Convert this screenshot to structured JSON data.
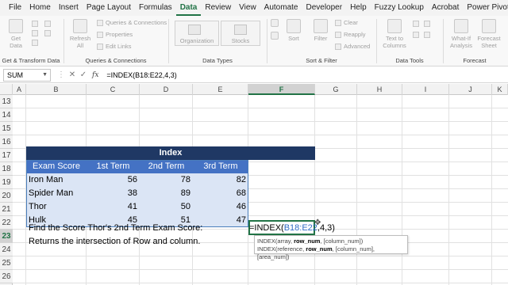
{
  "menu": {
    "tabs": [
      "File",
      "Home",
      "Insert",
      "Page Layout",
      "Formulas",
      "Data",
      "Review",
      "View",
      "Automate",
      "Developer",
      "Help",
      "Fuzzy Lookup",
      "Acrobat",
      "Power Pivot"
    ],
    "active": "Data"
  },
  "ribbon": {
    "get_data": "Get Data",
    "group_get": "Get & Transform Data",
    "refresh": "Refresh All",
    "queries": "Queries & Connections",
    "properties": "Properties",
    "edit_links": "Edit Links",
    "group_queries": "Queries & Connections",
    "organization": "Organization",
    "stocks": "Stocks",
    "group_types": "Data Types",
    "sort": "Sort",
    "filter": "Filter",
    "clear": "Clear",
    "reapply": "Reapply",
    "advanced": "Advanced",
    "group_sort": "Sort & Filter",
    "text_to_columns": "Text to Columns",
    "group_tools": "Data Tools",
    "what_if": "What-If Analysis",
    "forecast_sheet": "Forecast Sheet",
    "group_forecast": "Forecast"
  },
  "formula_bar": {
    "name_box": "SUM",
    "cancel": "✕",
    "enter": "✓",
    "fx": "fx",
    "formula": "=INDEX(B18:E22,4,3)"
  },
  "columns": [
    "A",
    "B",
    "C",
    "D",
    "E",
    "F",
    "G",
    "H",
    "I",
    "J",
    "K"
  ],
  "active_column": "F",
  "rows": [
    "13",
    "14",
    "15",
    "16",
    "17",
    "18",
    "19",
    "20",
    "21",
    "22",
    "23",
    "24",
    "25",
    "26"
  ],
  "active_row": "23",
  "table": {
    "title": "Index",
    "headers": [
      "Exam Score",
      "1st Term",
      "2nd Term",
      "3rd Term"
    ],
    "rows": [
      {
        "name": "Iron Man",
        "t1": "56",
        "t2": "78",
        "t3": "82"
      },
      {
        "name": "Spider Man",
        "t1": "38",
        "t2": "89",
        "t3": "68"
      },
      {
        "name": "Thor",
        "t1": "41",
        "t2": "50",
        "t3": "46"
      },
      {
        "name": "Hulk",
        "t1": "45",
        "t2": "51",
        "t3": "47"
      }
    ]
  },
  "notes": {
    "find": "Find the Score Thor's 2nd Term Exam Score:",
    "returns": "Returns the intersection of Row and column."
  },
  "edit": {
    "prefix": "=INDEX(",
    "ref": "B18:E22",
    "suffix": ",4,3)"
  },
  "tooltip": {
    "line1_pre": "INDEX(array, ",
    "line1_b": "row_num",
    "line1_post": ", [column_num])",
    "line2_pre": "INDEX(reference, ",
    "line2_b": "row_num",
    "line2_post": ", [column_num], [area_num])"
  }
}
